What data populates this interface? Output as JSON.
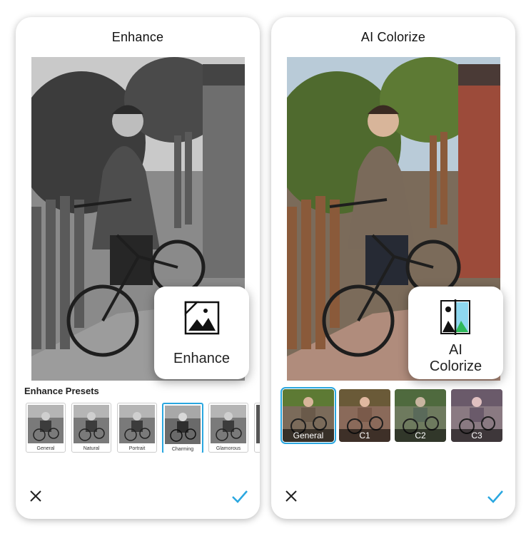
{
  "left_panel": {
    "title": "Enhance",
    "badge_label": "Enhance",
    "badge_icon": "image-enhance-icon",
    "presets_title": "Enhance Presets",
    "presets": [
      {
        "label": "General",
        "selected": false
      },
      {
        "label": "Natural",
        "selected": false
      },
      {
        "label": "Portrait",
        "selected": false
      },
      {
        "label": "Charming",
        "selected": true
      },
      {
        "label": "Glamorous",
        "selected": false
      }
    ],
    "close_icon": "close-icon",
    "confirm_icon": "checkmark-icon"
  },
  "right_panel": {
    "title": "AI Colorize",
    "badge_label_line1": "AI",
    "badge_label_line2": "Colorize",
    "badge_icon": "colorize-compare-icon",
    "styles": [
      {
        "label": "General",
        "selected": true
      },
      {
        "label": "C1",
        "selected": false
      },
      {
        "label": "C2",
        "selected": false
      },
      {
        "label": "C3",
        "selected": false
      }
    ],
    "close_icon": "close-icon",
    "confirm_icon": "checkmark-icon"
  },
  "colors": {
    "accent": "#2aa7e0",
    "text": "#222222"
  }
}
